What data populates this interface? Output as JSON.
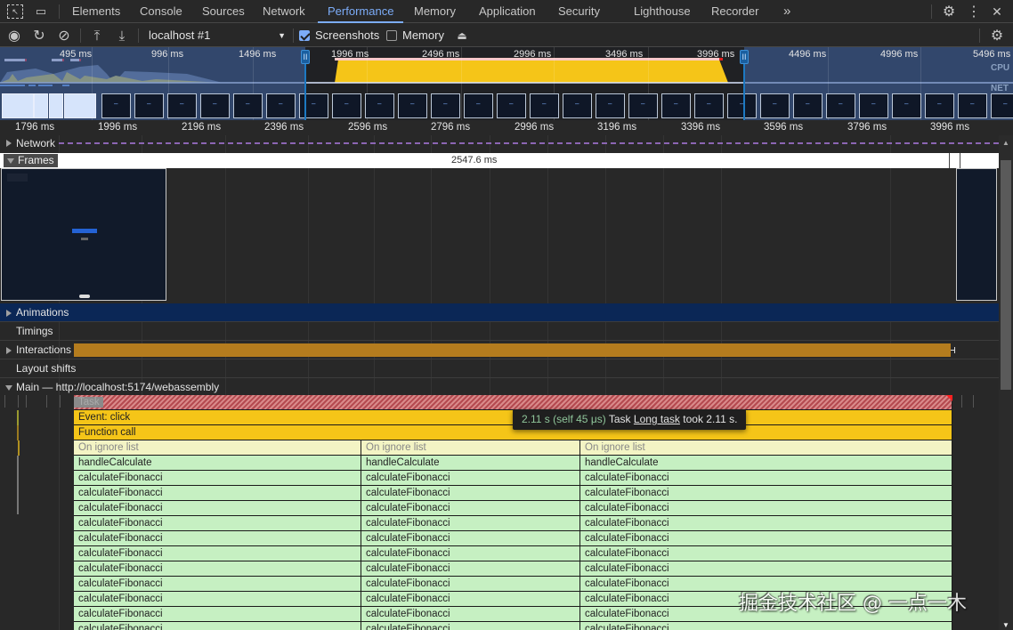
{
  "tabbar": {
    "tabs": [
      {
        "label": "Elements",
        "active": false
      },
      {
        "label": "Console",
        "active": false
      },
      {
        "label": "Sources",
        "active": false
      },
      {
        "label": "Network",
        "active": false
      },
      {
        "label": "Performance",
        "active": true
      },
      {
        "label": "Memory",
        "active": false
      },
      {
        "label": "Application",
        "active": false
      },
      {
        "label": "Security",
        "active": false
      },
      {
        "label": "Lighthouse",
        "active": false
      },
      {
        "label": "Recorder",
        "active": false
      }
    ],
    "more": "»",
    "icons": {
      "inspect": "⬚",
      "device": "▭",
      "settings": "⚙",
      "menu": "⋮",
      "close": "✕"
    }
  },
  "toolbar": {
    "record": "◉",
    "reload": "↻",
    "clear": "⊘",
    "upload": "⤒",
    "download": "⤓",
    "target": "localhost #1",
    "screenshots_label": "Screenshots",
    "screenshots_checked": true,
    "memory_label": "Memory",
    "memory_checked": false,
    "gc_icon": "🧹",
    "settings": "⚙"
  },
  "overview": {
    "labels": [
      "495 ms",
      "996 ms",
      "1496 ms",
      "1996 ms",
      "2496 ms",
      "2996 ms",
      "3496 ms",
      "3996 ms",
      "4496 ms",
      "4996 ms",
      "5496 ms"
    ],
    "cpu_label": "CPU",
    "net_label": "NET",
    "handle": "II"
  },
  "ruler": {
    "labels": [
      "1796 ms",
      "1996 ms",
      "2196 ms",
      "2396 ms",
      "2596 ms",
      "2796 ms",
      "2996 ms",
      "3196 ms",
      "3396 ms",
      "3596 ms",
      "3796 ms",
      "3996 ms"
    ]
  },
  "tracks": {
    "network": "Network",
    "frames": "Frames",
    "frame_duration": "2547.6 ms",
    "animations": "Animations",
    "timings": "Timings",
    "interactions": "Interactions",
    "layout_shifts": "Layout shifts",
    "main": "Main — http://localhost:5174/webassembly"
  },
  "flame": {
    "task": "Task",
    "event": "Event: click",
    "function_call": "Function call",
    "columns": [
      {
        "ignore": "On ignore list",
        "handler": "handleCalculate",
        "fn": "calculateFibonacci"
      },
      {
        "ignore": "On ignore list",
        "handler": "handleCalculate",
        "fn": "calculateFibonacci"
      },
      {
        "ignore": "On ignore list",
        "handler": "handleCalculate",
        "fn": "calculateFibonacci"
      }
    ],
    "fib_rows": 11
  },
  "tooltip": {
    "time": "2.11 s (self 45 μs)",
    "name": "Task",
    "link": "Long task",
    "rest": "took 2.11 s."
  },
  "watermark": "掘金技术社区 @ 一点一木"
}
